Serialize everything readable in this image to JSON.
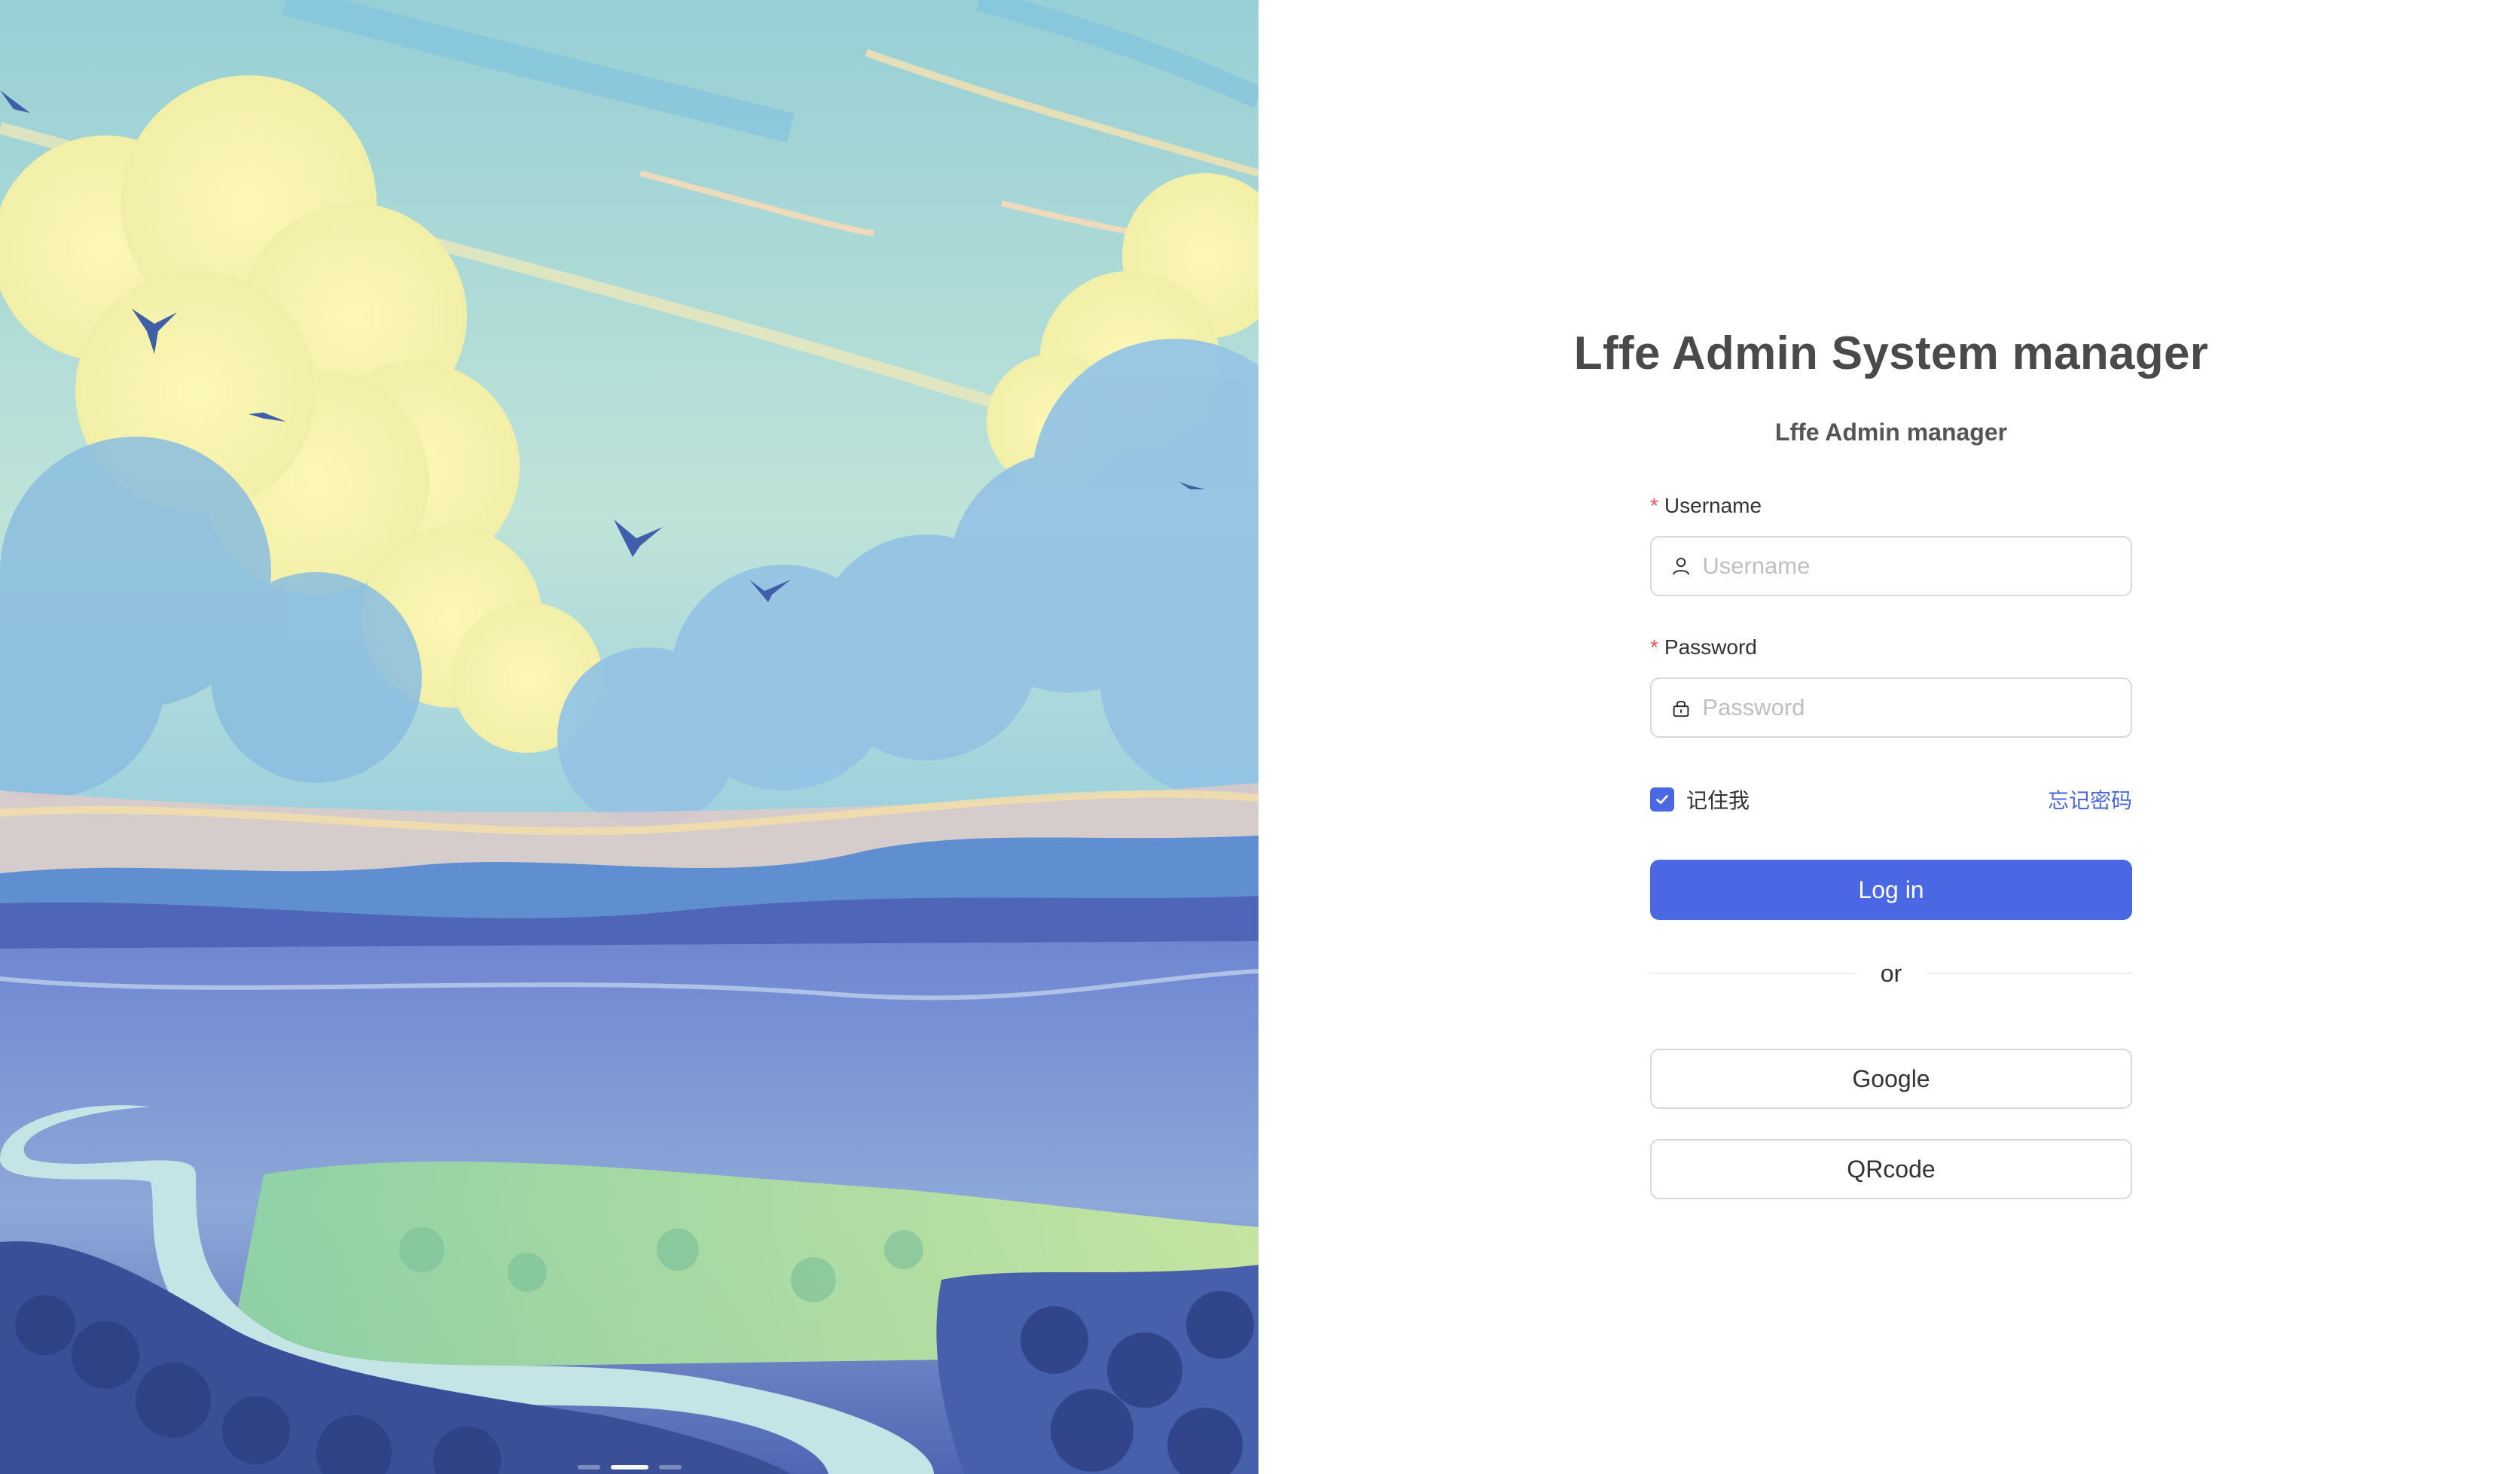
{
  "login": {
    "title": "Lffe Admin System manager",
    "subtitle": "Lffe Admin manager",
    "username": {
      "required_mark": "*",
      "label": "Username",
      "placeholder": "Username",
      "value": ""
    },
    "password": {
      "required_mark": "*",
      "label": "Password",
      "placeholder": "Password",
      "value": ""
    },
    "remember_me": {
      "label": "记住我",
      "checked": true
    },
    "forgot_password_label": "忘记密码",
    "login_button_label": "Log in",
    "divider_text": "or",
    "google_button_label": "Google",
    "qrcode_button_label": "QRcode"
  },
  "colors": {
    "primary": "#4a68e3",
    "required": "#ff4d4f",
    "border": "#d9d9d9",
    "title_text": "#4a4a4a"
  },
  "icons": {
    "username_icon": "user-icon",
    "password_icon": "lock-icon",
    "checkbox_icon": "check-icon"
  },
  "carousel": {
    "slide_count": 3,
    "active_index": 1
  }
}
